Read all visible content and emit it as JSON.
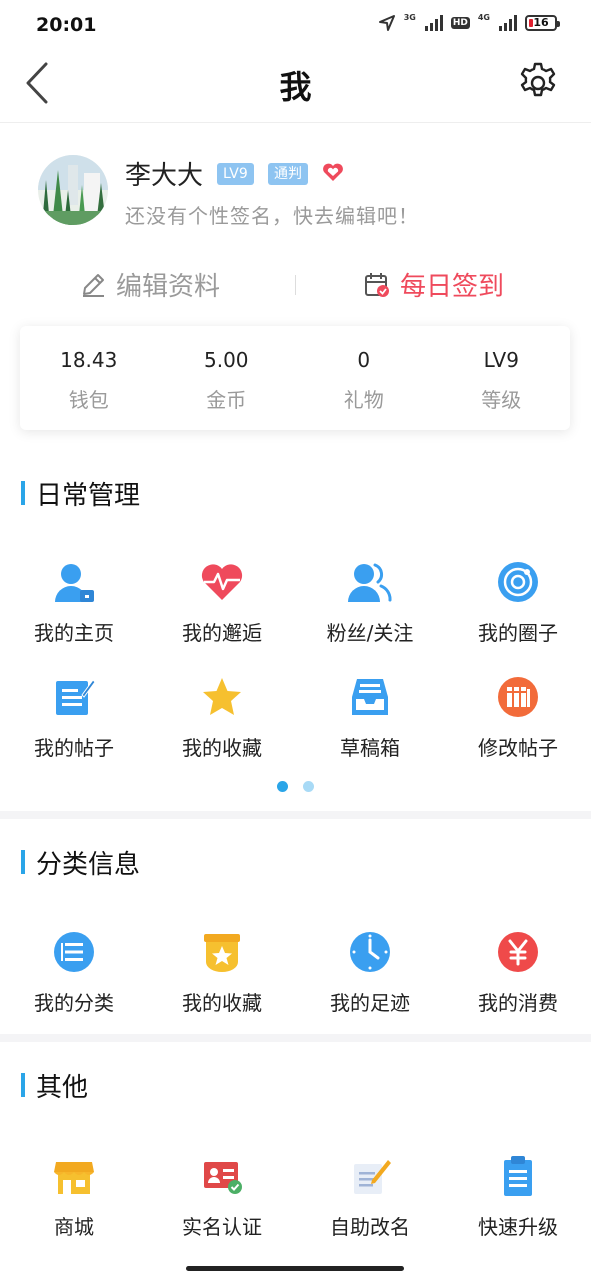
{
  "status_bar": {
    "time": "20:01",
    "net1": "3G",
    "net2": "4G",
    "hd": "HD",
    "battery": "16"
  },
  "nav": {
    "title": "我"
  },
  "profile": {
    "name": "李大大",
    "level_badge": "LV9",
    "title_badge": "通判",
    "signature": "还没有个性签名，快去编辑吧！"
  },
  "actions": {
    "edit": "编辑资料",
    "checkin": "每日签到"
  },
  "stats": [
    {
      "value": "18.43",
      "label": "钱包"
    },
    {
      "value": "5.00",
      "label": "金币"
    },
    {
      "value": "0",
      "label": "礼物"
    },
    {
      "value": "LV9",
      "label": "等级"
    }
  ],
  "daily": {
    "title": "日常管理",
    "items": [
      {
        "label": "我的主页",
        "icon": "user-home-icon"
      },
      {
        "label": "我的邂逅",
        "icon": "heartbeat-icon"
      },
      {
        "label": "粉丝/关注",
        "icon": "users-icon"
      },
      {
        "label": "我的圈子",
        "icon": "circle-target-icon"
      },
      {
        "label": "我的帖子",
        "icon": "post-edit-icon"
      },
      {
        "label": "我的收藏",
        "icon": "star-icon"
      },
      {
        "label": "草稿箱",
        "icon": "inbox-tray-icon"
      },
      {
        "label": "修改帖子",
        "icon": "books-icon"
      }
    ]
  },
  "category": {
    "title": "分类信息",
    "items": [
      {
        "label": "我的分类",
        "icon": "list-icon"
      },
      {
        "label": "我的收藏",
        "icon": "star-box-icon"
      },
      {
        "label": "我的足迹",
        "icon": "clock-icon"
      },
      {
        "label": "我的消费",
        "icon": "yen-icon"
      }
    ]
  },
  "other": {
    "title": "其他",
    "items": [
      {
        "label": "商城",
        "icon": "shop-icon"
      },
      {
        "label": "实名认证",
        "icon": "id-card-icon"
      },
      {
        "label": "自助改名",
        "icon": "rename-note-icon"
      },
      {
        "label": "快速升级",
        "icon": "clipboard-icon"
      }
    ]
  },
  "colors": {
    "accent_blue": "#3a9ff0",
    "checkin_red": "#ef4a5c",
    "section_bar": "#2aa5e8"
  }
}
